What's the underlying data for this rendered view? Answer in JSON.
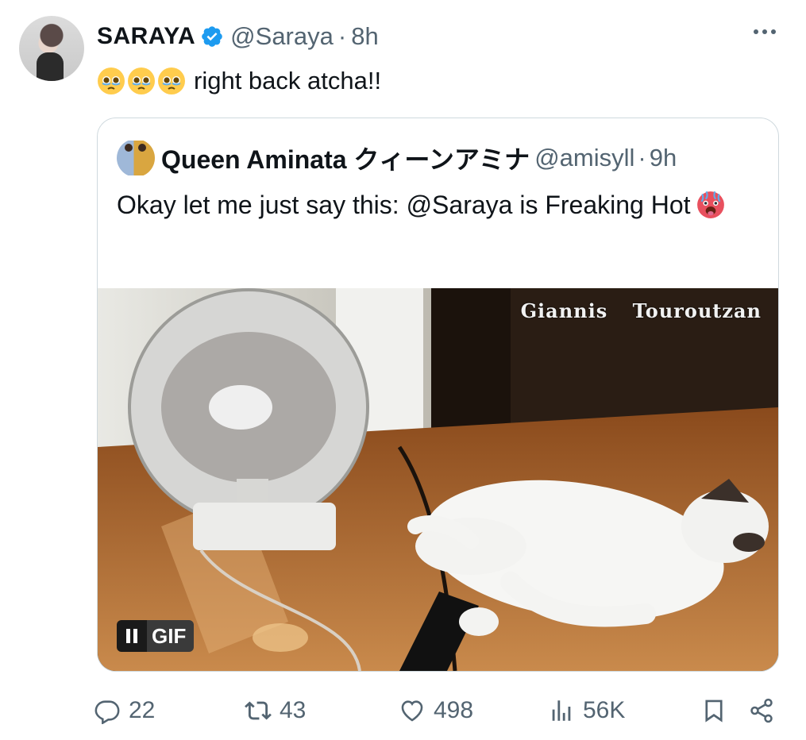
{
  "tweet": {
    "author": {
      "display_name": "SARAYA",
      "handle": "@Saraya",
      "verified": true,
      "avatar_icon": "profile-photo"
    },
    "separator": "·",
    "time": "8h",
    "more_icon": "more-horizontal-icon",
    "emoji": [
      "face-holding-back-tears",
      "face-holding-back-tears",
      "face-holding-back-tears"
    ],
    "text": "right back atcha!!"
  },
  "quote": {
    "author": {
      "display_name": "Queen Aminata クィーンアミナ",
      "handle": "@amisyll",
      "avatar_icon": "profile-photo"
    },
    "separator": "·",
    "time": "9h",
    "text": "Okay let me just say this: @Saraya is Freaking Hot",
    "trailing_emoji": "hot-face",
    "media": {
      "type": "gif",
      "watermark": "Giannis Touroutzan",
      "badge_label": "GIF",
      "badge_icon": "pause-icon"
    }
  },
  "actions": {
    "reply": {
      "icon": "reply-icon",
      "count": "22"
    },
    "retweet": {
      "icon": "retweet-icon",
      "count": "43"
    },
    "like": {
      "icon": "heart-icon",
      "count": "498"
    },
    "views": {
      "icon": "views-icon",
      "count": "56K"
    },
    "bookmark": {
      "icon": "bookmark-icon"
    },
    "share": {
      "icon": "share-icon"
    }
  },
  "colors": {
    "text_primary": "#0f1419",
    "text_secondary": "#536471",
    "border": "#cfd9de",
    "verified_blue": "#1d9bf0"
  }
}
